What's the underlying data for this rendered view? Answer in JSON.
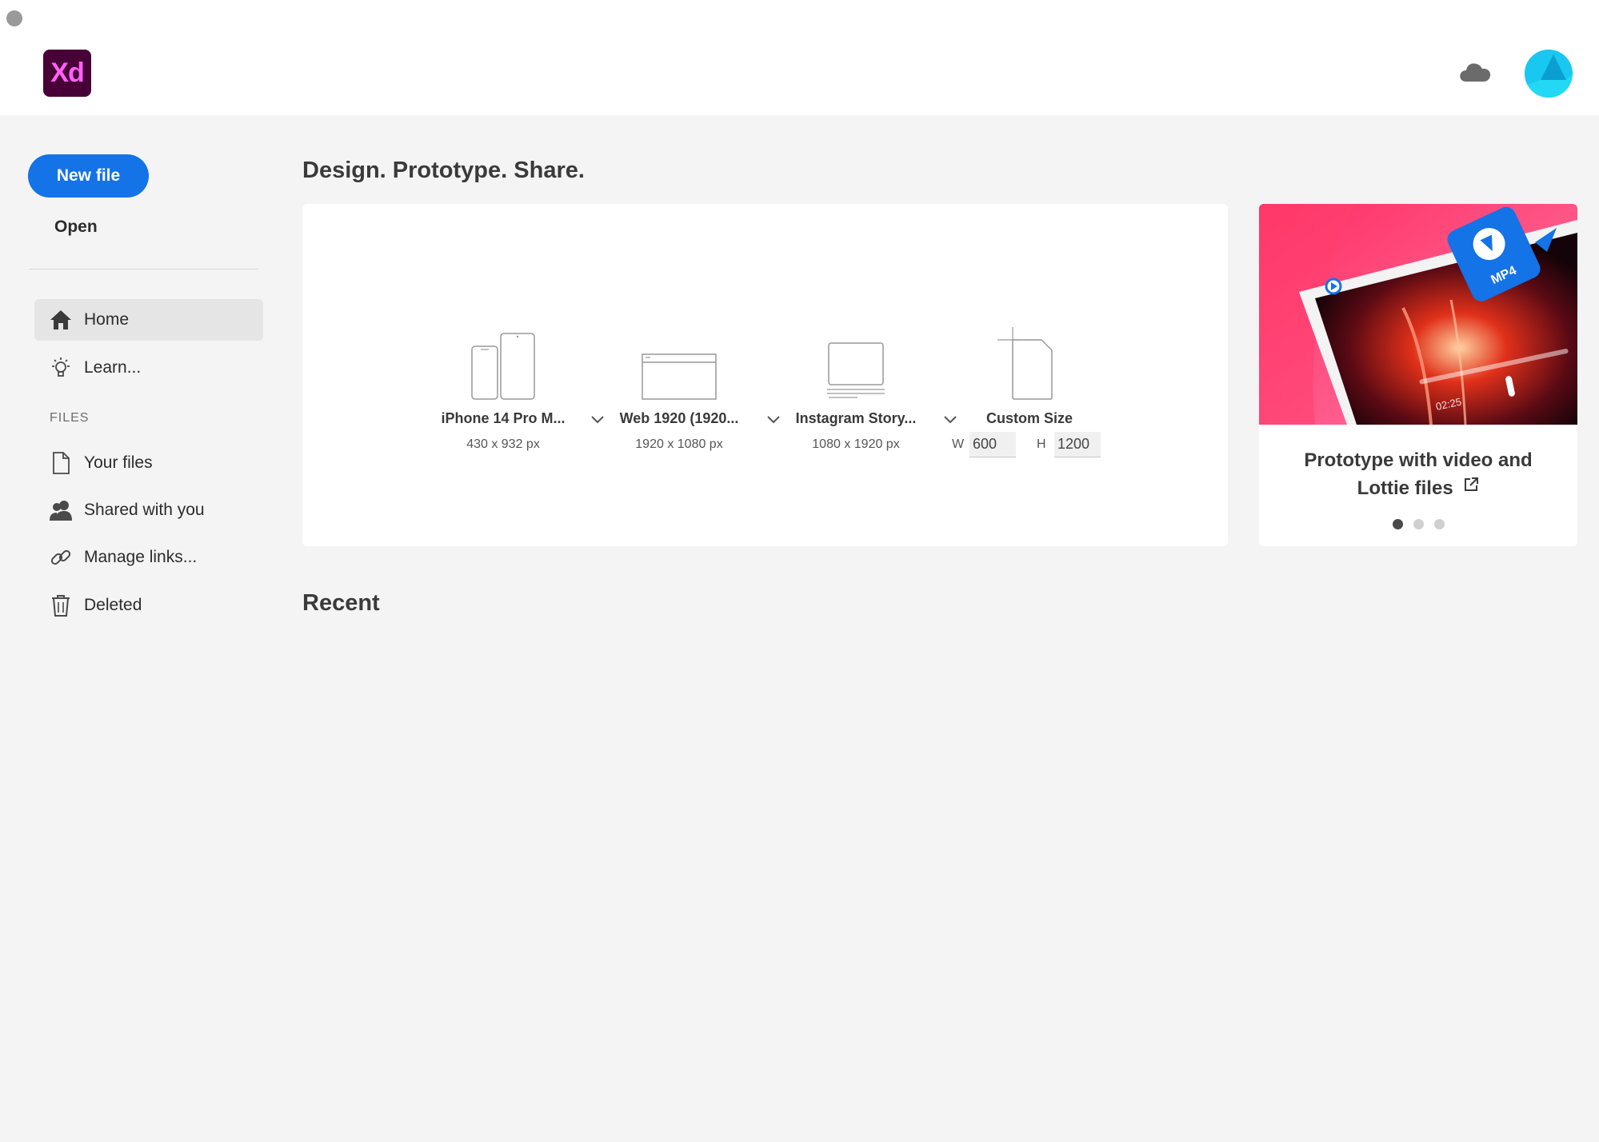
{
  "app": {
    "logo_text": "Xd",
    "cloud_icon": "cloud-icon",
    "avatar_icon": "user-avatar"
  },
  "sidebar": {
    "new_file_label": "New file",
    "open_label": "Open",
    "nav": [
      {
        "label": "Home",
        "icon": "home-icon",
        "active": true
      },
      {
        "label": "Learn...",
        "icon": "lightbulb-icon",
        "active": false
      }
    ],
    "files_heading": "FILES",
    "files": [
      {
        "label": "Your files",
        "icon": "document-icon"
      },
      {
        "label": "Shared with you",
        "icon": "users-icon"
      },
      {
        "label": "Manage links...",
        "icon": "link-icon"
      },
      {
        "label": "Deleted",
        "icon": "trash-icon"
      }
    ]
  },
  "main": {
    "headline": "Design. Prototype. Share.",
    "presets": [
      {
        "label": "iPhone 14 Pro M...",
        "dims": "430 x 932 px",
        "icon": "phone-tablet-icon"
      },
      {
        "label": "Web 1920 (1920...",
        "dims": "1920 x 1080 px",
        "icon": "browser-window-icon"
      },
      {
        "label": "Instagram Story...",
        "dims": "1080 x 1920 px",
        "icon": "monitor-icon"
      },
      {
        "label": "Custom Size",
        "icon": "custom-page-icon"
      }
    ],
    "custom": {
      "w_label": "W",
      "w_value": "600",
      "h_label": "H",
      "h_value": "1200"
    },
    "promo": {
      "title_line1": "Prototype with video and",
      "title_line2": "Lottie files",
      "badge_text": "MP4",
      "time_text": "02:25",
      "dots_count": 3,
      "active_dot": 0
    },
    "recent_heading": "Recent"
  },
  "colors": {
    "accent": "#1473e6",
    "logo_bg": "#470137",
    "logo_fg": "#ff61f6",
    "page_bg": "#f4f4f4"
  }
}
